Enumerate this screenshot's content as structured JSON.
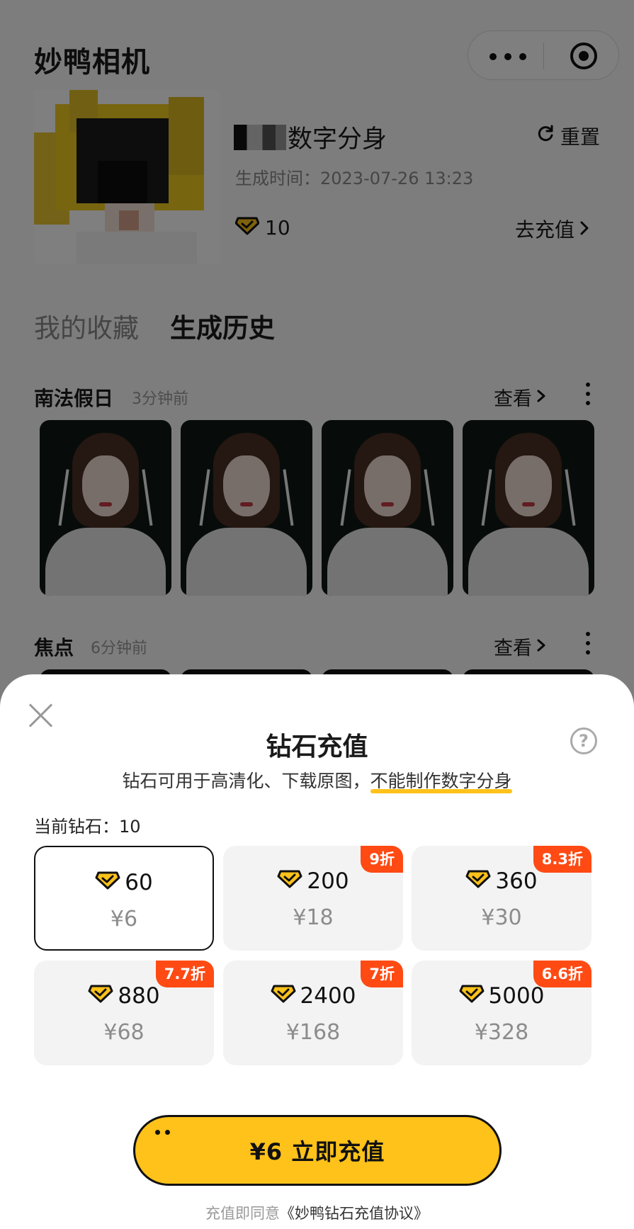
{
  "app": {
    "title": "妙鸭相机"
  },
  "profile": {
    "name_suffix": "数字分身",
    "gen_time": "生成时间：2023-07-26 13:23",
    "diamonds": "10",
    "reset_label": "重置",
    "recharge_label": "去充值"
  },
  "tabs": [
    {
      "label": "我的收藏",
      "active": false
    },
    {
      "label": "生成历史",
      "active": true
    }
  ],
  "sections": [
    {
      "title": "南法假日",
      "time": "3分钟前",
      "view_label": "查看"
    },
    {
      "title": "焦点",
      "time": "6分钟前",
      "view_label": "查看"
    }
  ],
  "sheet": {
    "title": "钻石充值",
    "help_glyph": "?",
    "desc_prefix": "钻石可用于高清化、下载原图，",
    "desc_highlight": "不能制作数字分身",
    "current_label": "当前钻石：10",
    "packages": [
      {
        "amount": "60",
        "price": "¥6",
        "badge": "",
        "selected": true
      },
      {
        "amount": "200",
        "price": "¥18",
        "badge": "9折",
        "selected": false
      },
      {
        "amount": "360",
        "price": "¥30",
        "badge": "8.3折",
        "selected": false
      },
      {
        "amount": "880",
        "price": "¥68",
        "badge": "7.7折",
        "selected": false
      },
      {
        "amount": "2400",
        "price": "¥168",
        "badge": "7折",
        "selected": false
      },
      {
        "amount": "5000",
        "price": "¥328",
        "badge": "6.6折",
        "selected": false
      }
    ],
    "pay_label": "¥6 立即充值",
    "agree_prefix": "充值即同意",
    "agree_link": "《妙鸭钻石充值协议》"
  },
  "colors": {
    "accent": "#ffc21a",
    "badge": "#ff4a14",
    "overlay": "rgba(0,0,0,0.5)"
  },
  "icons": [
    "more-dots-icon",
    "target-icon",
    "refresh-icon",
    "diamond-icon",
    "chevron-right-icon",
    "vertical-dots-icon",
    "close-icon",
    "help-icon"
  ]
}
